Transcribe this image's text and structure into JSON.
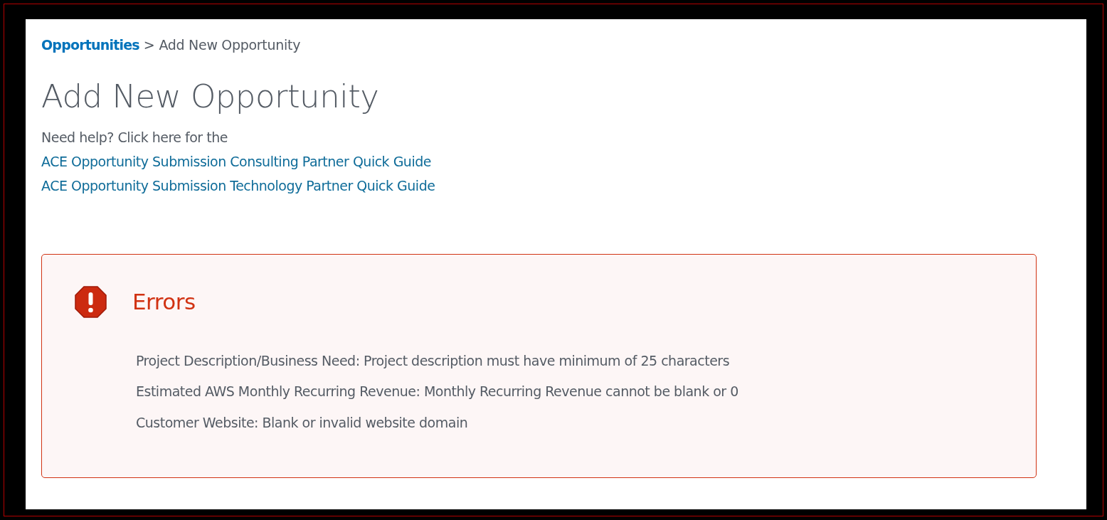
{
  "breadcrumb": {
    "link": "Opportunities",
    "separator": ">",
    "current": "Add New Opportunity"
  },
  "title": "Add New Opportunity",
  "help": {
    "text": "Need help? Click here for the",
    "links": [
      "ACE Opportunity Submission Consulting Partner Quick Guide",
      "ACE Opportunity Submission Technology Partner Quick Guide"
    ]
  },
  "errors": {
    "title": "Errors",
    "messages": [
      "Project Description/Business Need: Project description must have minimum of 25 characters",
      "Estimated AWS Monthly Recurring Revenue: Monthly Recurring Revenue cannot be blank or 0",
      "Customer Website: Blank or invalid website domain"
    ]
  }
}
